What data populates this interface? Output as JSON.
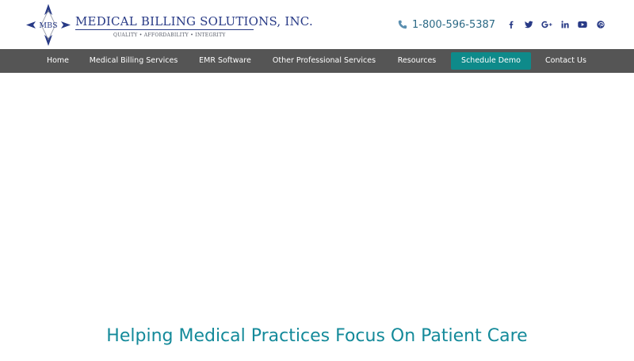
{
  "header": {
    "logo": {
      "initials": "MBS",
      "company_name": "MEDICAL BILLING SOLUTIONS, INC.",
      "tagline": "QUALITY • AFFORDABILITY • INTEGRITY"
    },
    "phone": "1-800-596-5387",
    "social": [
      {
        "icon": "facebook-icon"
      },
      {
        "icon": "twitter-icon"
      },
      {
        "icon": "google-plus-icon"
      },
      {
        "icon": "linkedin-icon"
      },
      {
        "icon": "youtube-icon"
      },
      {
        "icon": "pinterest-icon"
      }
    ]
  },
  "nav": {
    "items": [
      {
        "label": "Home"
      },
      {
        "label": "Medical Billing Services"
      },
      {
        "label": "EMR Software"
      },
      {
        "label": "Other Professional Services"
      },
      {
        "label": "Resources"
      },
      {
        "label": "Schedule Demo"
      },
      {
        "label": "Contact Us"
      }
    ]
  },
  "hero": {
    "heading": "Helping Medical Practices Focus On Patient Care"
  },
  "colors": {
    "brand_navy": "#283a86",
    "nav_background": "#555555",
    "demo_button": "#0e8a8a",
    "heading_teal": "#148a9a"
  }
}
